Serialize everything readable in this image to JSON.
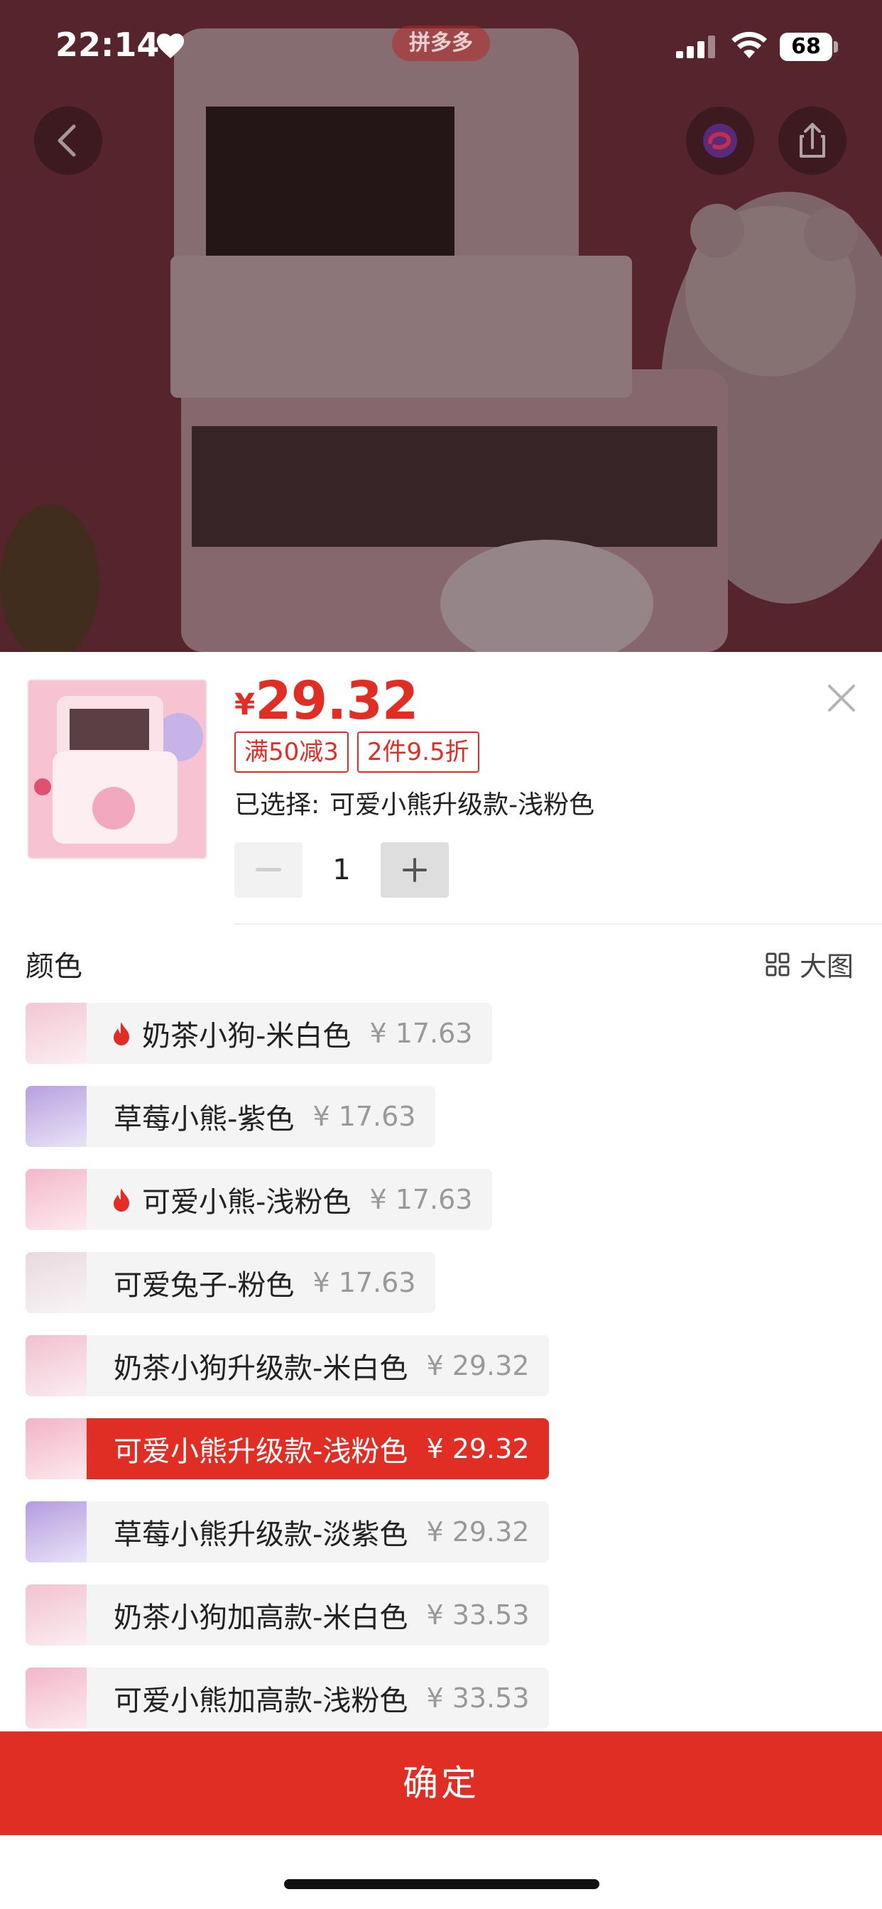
{
  "status_bar": {
    "time": "22:14",
    "carrier_badge": "拼多多",
    "battery": "68"
  },
  "product": {
    "price_symbol": "¥",
    "price": "29.32",
    "tags": [
      "满50减3",
      "2件9.5折"
    ],
    "selected_prefix": "已选择:",
    "selected_value": "可爱小熊升级款-浅粉色",
    "quantity": "1"
  },
  "options_section": {
    "title": "颜色",
    "big_image_label": "大图"
  },
  "options": [
    {
      "label": "奶茶小狗-米白色",
      "price": "¥ 17.63",
      "hot": true,
      "selected": false,
      "thumb": "#f3c6d3"
    },
    {
      "label": "草莓小熊-紫色",
      "price": "¥ 17.63",
      "hot": false,
      "selected": false,
      "thumb": "#b7a0e0"
    },
    {
      "label": "可爱小熊-浅粉色",
      "price": "¥ 17.63",
      "hot": true,
      "selected": false,
      "thumb": "#f5b7c9"
    },
    {
      "label": "可爱兔子-粉色",
      "price": "¥ 17.63",
      "hot": false,
      "selected": false,
      "thumb": "#e9d9de"
    },
    {
      "label": "奶茶小狗升级款-米白色",
      "price": "¥ 29.32",
      "hot": false,
      "selected": false,
      "thumb": "#f1c0cf"
    },
    {
      "label": "可爱小熊升级款-浅粉色",
      "price": "¥ 29.32",
      "hot": false,
      "selected": true,
      "thumb": "#f4b3c6"
    },
    {
      "label": "草莓小熊升级款-淡紫色",
      "price": "¥ 29.32",
      "hot": false,
      "selected": false,
      "thumb": "#b49ce0"
    },
    {
      "label": "奶茶小狗加高款-米白色",
      "price": "¥ 33.53",
      "hot": false,
      "selected": false,
      "thumb": "#f2c2d0"
    },
    {
      "label": "可爱小熊加高款-浅粉色",
      "price": "¥ 33.53",
      "hot": false,
      "selected": false,
      "thumb": "#f3b6c8"
    }
  ],
  "confirm_label": "确定",
  "colors": {
    "accent": "#e02e24",
    "option_bg": "#f4f4f4",
    "price_grey": "#999999"
  }
}
